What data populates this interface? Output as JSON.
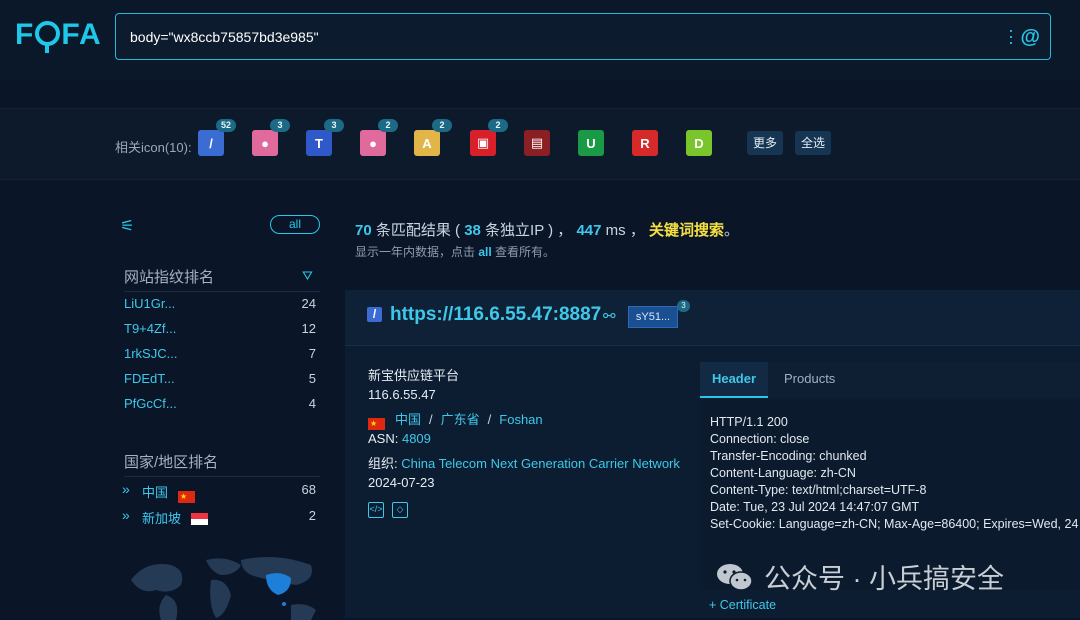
{
  "header": {
    "logo": "FOFA",
    "search_value": "body=\"wx8ccb75857bd3e985\""
  },
  "icon_bar": {
    "label": "相关icon(10):",
    "icons": [
      {
        "name": "bolt-favicon",
        "badge": "52",
        "color": "#3b6cd4",
        "glyph": "/"
      },
      {
        "name": "pink-blob-favicon",
        "badge": "3",
        "color": "#e06a9b",
        "glyph": "●"
      },
      {
        "name": "ot-favicon",
        "badge": "3",
        "color": "#2f58c8",
        "glyph": "T"
      },
      {
        "name": "pink-blob-favicon-2",
        "badge": "2",
        "color": "#e06a9b",
        "glyph": "●"
      },
      {
        "name": "gold-coin-favicon",
        "badge": "2",
        "color": "#e2b548",
        "glyph": "A"
      },
      {
        "name": "red-box-favicon",
        "badge": "2",
        "color": "#d8202a",
        "glyph": "▣"
      },
      {
        "name": "dark-red-favicon",
        "badge": "",
        "color": "#8a1f24",
        "glyph": "▤"
      },
      {
        "name": "green-u-favicon",
        "badge": "",
        "color": "#1a9a44",
        "glyph": "U"
      },
      {
        "name": "red-r-favicon",
        "badge": "",
        "color": "#d62a2a",
        "glyph": "R"
      },
      {
        "name": "lime-favicon",
        "badge": "",
        "color": "#7ac52b",
        "glyph": "D"
      }
    ],
    "more_label": "更多",
    "select_all_label": "全选"
  },
  "sidebar": {
    "all_label": "all",
    "fingerprint_title": "网站指纹排名",
    "fingerprints": [
      {
        "name": "LiU1Gr...",
        "count": "24"
      },
      {
        "name": "T9+4Zf...",
        "count": "12"
      },
      {
        "name": "1rkSJC...",
        "count": "7"
      },
      {
        "name": "FDEdT...",
        "count": "5"
      },
      {
        "name": "PfGcCf...",
        "count": "4"
      }
    ],
    "country_title": "国家/地区排名",
    "countries": [
      {
        "name": "中国",
        "count": "68"
      },
      {
        "name": "新加坡",
        "count": "2"
      }
    ]
  },
  "summary": {
    "count": "70",
    "text1": " 条匹配结果 ( ",
    "unique_ip": "38",
    "text2": " 条独立IP ) ， ",
    "ms": "447",
    "text3": " ms ， ",
    "keyword_search": "关键词搜索",
    "text4": "。",
    "sub_text1": "显示一年内数据，点击 ",
    "sub_link": "all",
    "sub_text2": " 查看所有。"
  },
  "result": {
    "url": "https://116.6.55.47:8887",
    "tag": "sY51...",
    "tag_badge": "3",
    "title": "新宝供应链平台",
    "ip": "116.6.55.47",
    "country": "中国",
    "province": "广东省",
    "city": "Foshan",
    "asn_label": "ASN: ",
    "asn": "4809",
    "org_label": "组织: ",
    "org": "China Telecom Next Generation Carrier Network",
    "date": "2024-07-23",
    "tab_header": "Header",
    "tab_products": "Products",
    "header_lines": [
      "HTTP/1.1 200",
      "Connection: close",
      "Transfer-Encoding: chunked",
      "Content-Language: zh-CN",
      "Content-Type: text/html;charset=UTF-8",
      "Date: Tue, 23 Jul 2024 14:47:07 GMT",
      "Set-Cookie: Language=zh-CN; Max-Age=86400; Expires=Wed, 24"
    ],
    "certificate": "+ Certificate"
  },
  "watermark": "公众号 · 小兵搞安全"
}
